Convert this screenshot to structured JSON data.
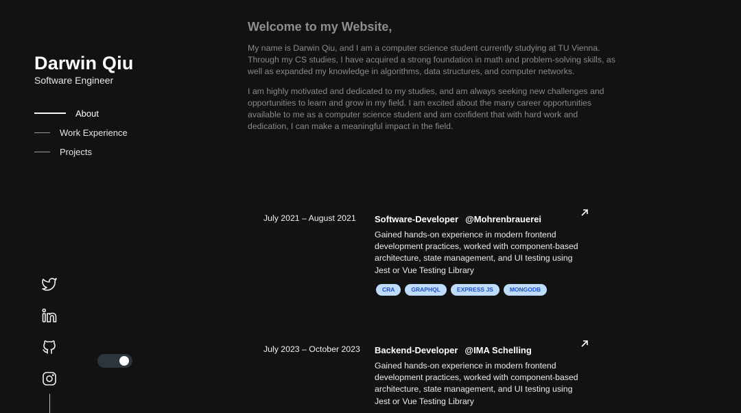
{
  "sidebar": {
    "name": "Darwin Qiu",
    "role": "Software Engineer",
    "nav": [
      {
        "label": "About",
        "active": true
      },
      {
        "label": "Work Experience",
        "active": false
      },
      {
        "label": "Projects",
        "active": false
      }
    ],
    "socials": [
      {
        "icon": "twitter-icon"
      },
      {
        "icon": "linkedin-icon"
      },
      {
        "icon": "github-icon"
      },
      {
        "icon": "instagram-icon"
      }
    ],
    "theme_toggle": {
      "on": true
    }
  },
  "about": {
    "heading": "Welcome to my Website,",
    "paragraphs": [
      "My name is Darwin Qiu, and I am a computer science student currently studying at TU Vienna. Through my CS studies, I have acquired a strong foundation in math and problem-solving skills, as well as expanded my knowledge in algorithms, data structures, and computer networks.",
      "I am highly motivated and dedicated to my studies, and am always seeking new challenges and opportunities to learn and grow in my field. I am excited about the many career opportunities available to me as a computer science student and am confident that with hard work and dedication, I can make a meaningful impact in the field."
    ]
  },
  "experience": [
    {
      "date": "July 2021 – August 2021",
      "title": "Software-Developer",
      "company": "@Mohrenbrauerei",
      "description": "Gained hands-on experience in modern frontend development practices, worked with component-based architecture, state management, and UI testing using Jest or Vue Testing Library",
      "tags": [
        "CRA",
        "GRAPHQL",
        "EXPRESS JS",
        "MONGODB"
      ]
    },
    {
      "date": "July 2023 – October 2023",
      "title": "Backend-Developer",
      "company": "@IMA Schelling",
      "description": "Gained hands-on experience in modern frontend development practices, worked with component-based architecture, state management, and UI testing using Jest or Vue Testing Library",
      "tags": []
    }
  ],
  "colors": {
    "background": "#121212",
    "tag_bg": "#bfdcff",
    "tag_text": "#1d4fd6",
    "toggle_track": "#2d343b"
  }
}
